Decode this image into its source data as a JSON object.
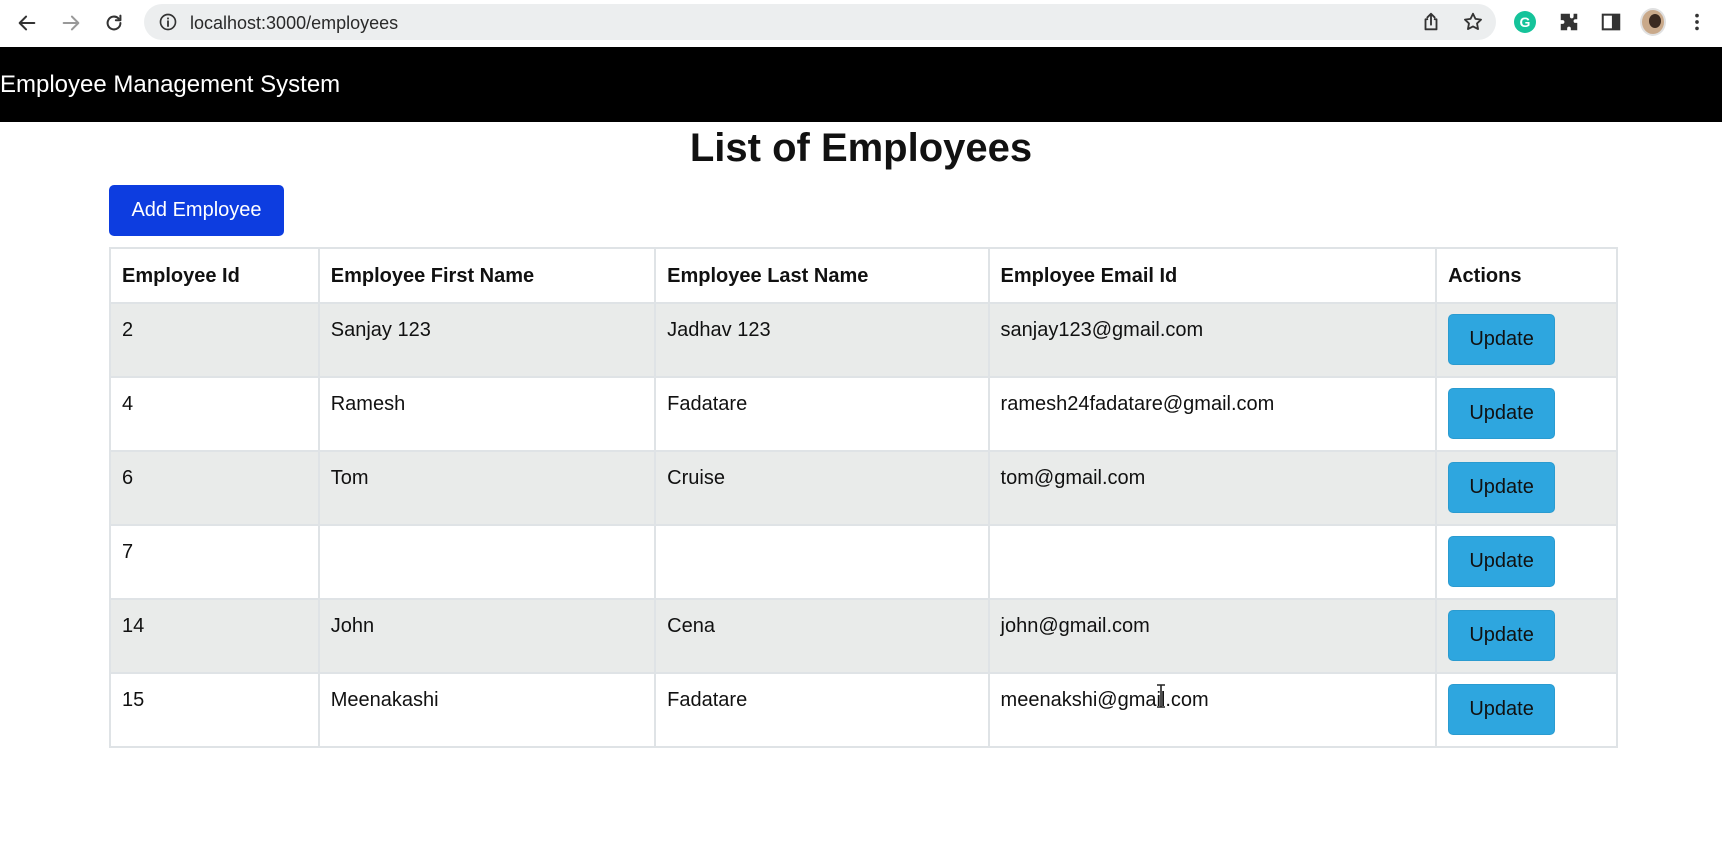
{
  "browser": {
    "url": "localhost:3000/employees"
  },
  "header": {
    "title": "Employee Management System"
  },
  "page": {
    "title": "List of Employees",
    "add_button_label": "Add Employee"
  },
  "table": {
    "columns": [
      "Employee Id",
      "Employee First Name",
      "Employee Last Name",
      "Employee Email Id",
      "Actions"
    ],
    "rows": [
      {
        "id": "2",
        "first_name": "Sanjay 123",
        "last_name": "Jadhav 123",
        "email": "sanjay123@gmail.com",
        "action": "Update"
      },
      {
        "id": "4",
        "first_name": "Ramesh",
        "last_name": "Fadatare",
        "email": "ramesh24fadatare@gmail.com",
        "action": "Update"
      },
      {
        "id": "6",
        "first_name": "Tom",
        "last_name": "Cruise",
        "email": "tom@gmail.com",
        "action": "Update"
      },
      {
        "id": "7",
        "first_name": "",
        "last_name": "",
        "email": "",
        "action": "Update"
      },
      {
        "id": "14",
        "first_name": "John",
        "last_name": "Cena",
        "email": "john@gmail.com",
        "action": "Update"
      },
      {
        "id": "15",
        "first_name": "Meenakashi",
        "last_name": "Fadatare",
        "email": "meenakshi@gmail.com",
        "action": "Update"
      }
    ]
  },
  "colors": {
    "header_bg": "#000000",
    "add_button": "#0d3de0",
    "update_button": "#2ea6df",
    "stripe": "#e9ebea"
  }
}
